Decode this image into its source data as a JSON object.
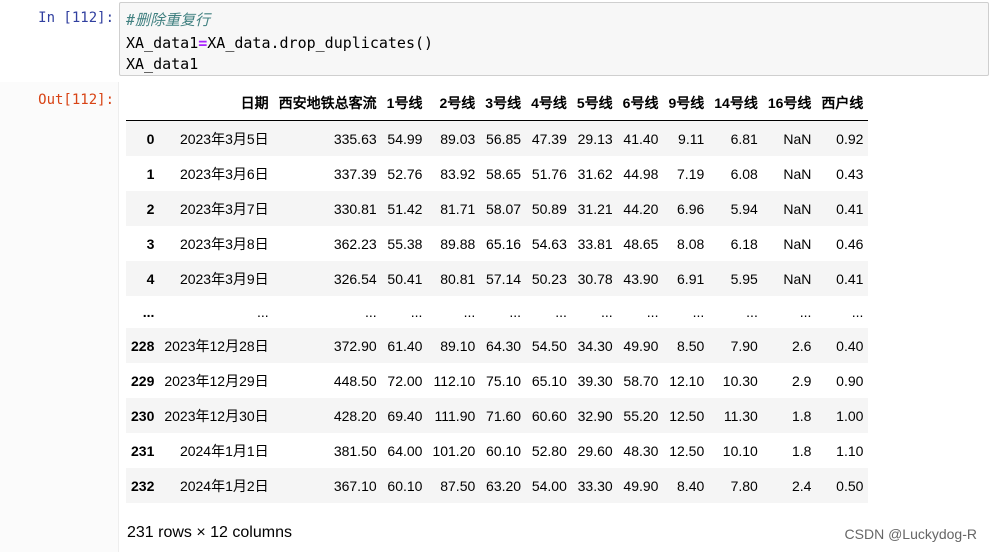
{
  "input_cell": {
    "prompt": "In  [112]:",
    "comment": "#删除重复行",
    "line2_lhs": "XA_data1",
    "line2_eq": "=",
    "line2_rhs": "XA_data.drop_duplicates()",
    "line3": "XA_data1"
  },
  "output_cell": {
    "prompt": "Out[112]:",
    "table": {
      "columns": [
        "",
        "日期",
        "西安地铁总客流",
        "1号线",
        "2号线",
        "3号线",
        "4号线",
        "5号线",
        "6号线",
        "9号线",
        "14号线",
        "16号线",
        "西户线"
      ],
      "rows": [
        [
          "0",
          "2023年3月5日",
          "335.63",
          "54.99",
          "89.03",
          "56.85",
          "47.39",
          "29.13",
          "41.40",
          "9.11",
          "6.81",
          "NaN",
          "0.92"
        ],
        [
          "1",
          "2023年3月6日",
          "337.39",
          "52.76",
          "83.92",
          "58.65",
          "51.76",
          "31.62",
          "44.98",
          "7.19",
          "6.08",
          "NaN",
          "0.43"
        ],
        [
          "2",
          "2023年3月7日",
          "330.81",
          "51.42",
          "81.71",
          "58.07",
          "50.89",
          "31.21",
          "44.20",
          "6.96",
          "5.94",
          "NaN",
          "0.41"
        ],
        [
          "3",
          "2023年3月8日",
          "362.23",
          "55.38",
          "89.88",
          "65.16",
          "54.63",
          "33.81",
          "48.65",
          "8.08",
          "6.18",
          "NaN",
          "0.46"
        ],
        [
          "4",
          "2023年3月9日",
          "326.54",
          "50.41",
          "80.81",
          "57.14",
          "50.23",
          "30.78",
          "43.90",
          "6.91",
          "5.95",
          "NaN",
          "0.41"
        ],
        [
          "...",
          "...",
          "...",
          "...",
          "...",
          "...",
          "...",
          "...",
          "...",
          "...",
          "...",
          "...",
          "..."
        ],
        [
          "228",
          "2023年12月28日",
          "372.90",
          "61.40",
          "89.10",
          "64.30",
          "54.50",
          "34.30",
          "49.90",
          "8.50",
          "7.90",
          "2.6",
          "0.40"
        ],
        [
          "229",
          "2023年12月29日",
          "448.50",
          "72.00",
          "112.10",
          "75.10",
          "65.10",
          "39.30",
          "58.70",
          "12.10",
          "10.30",
          "2.9",
          "0.90"
        ],
        [
          "230",
          "2023年12月30日",
          "428.20",
          "69.40",
          "111.90",
          "71.60",
          "60.60",
          "32.90",
          "55.20",
          "12.50",
          "11.30",
          "1.8",
          "1.00"
        ],
        [
          "231",
          "2024年1月1日",
          "381.50",
          "64.00",
          "101.20",
          "60.10",
          "52.80",
          "29.60",
          "48.30",
          "12.50",
          "10.10",
          "1.8",
          "1.10"
        ],
        [
          "232",
          "2024年1月2日",
          "367.10",
          "60.10",
          "87.50",
          "63.20",
          "54.00",
          "33.30",
          "49.90",
          "8.40",
          "7.80",
          "2.4",
          "0.50"
        ]
      ]
    },
    "footer": "231 rows × 12 columns"
  },
  "watermark": "CSDN @Luckydog-R"
}
